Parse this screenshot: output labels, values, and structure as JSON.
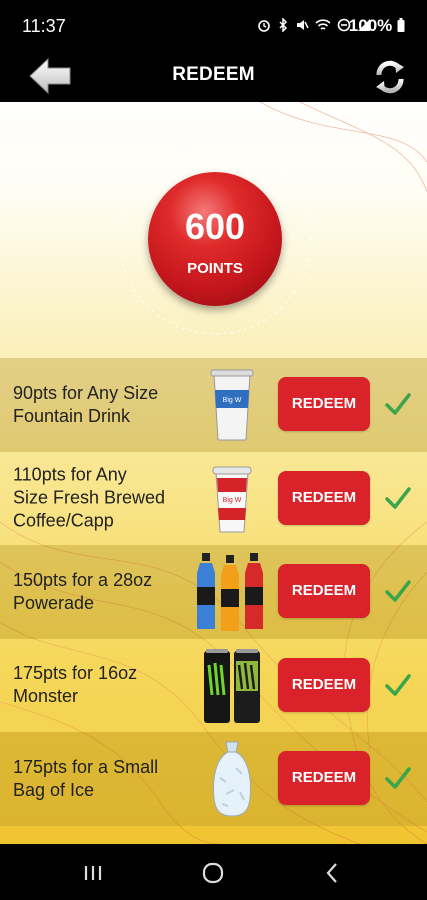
{
  "status": {
    "time": "11:37",
    "battery": "100%"
  },
  "header": {
    "title": "REDEEM"
  },
  "points": {
    "value": "600",
    "label": "POINTS"
  },
  "rewards": [
    {
      "line1": "90pts for Any Size",
      "line2": "Fountain Drink",
      "line3": "",
      "button": "REDEEM",
      "image": "fountain-cup-icon"
    },
    {
      "line1": "110pts for Any",
      "line2": "Size Fresh Brewed",
      "line3": "Coffee/Capp",
      "button": "REDEEM",
      "image": "coffee-cup-icon"
    },
    {
      "line1": "150pts for a 28oz",
      "line2": "Powerade",
      "line3": "",
      "button": "REDEEM",
      "image": "powerade-bottles-icon"
    },
    {
      "line1": "175pts for 16oz",
      "line2": "Monster",
      "line3": "",
      "button": "REDEEM",
      "image": "monster-cans-icon"
    },
    {
      "line1": "175pts for a Small",
      "line2": "Bag of Ice",
      "line3": "",
      "button": "REDEEM",
      "image": "ice-bag-icon"
    }
  ],
  "colors": {
    "accent": "#d9222a",
    "check": "#3aa54a",
    "header": "#000000"
  }
}
